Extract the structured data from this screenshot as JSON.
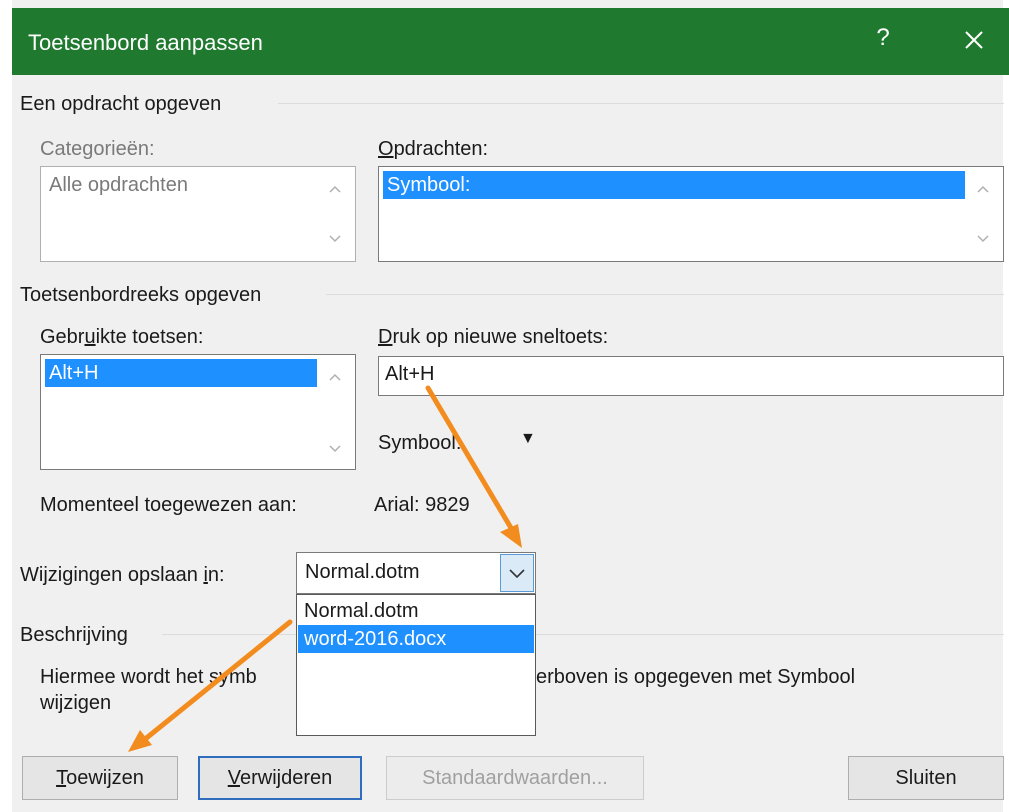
{
  "dialog": {
    "title": "Toetsenbord aanpassen",
    "help_label": "?",
    "close_icon": "close-icon"
  },
  "command_section": {
    "title": "Een opdracht opgeven",
    "categories_label": "Categorieën:",
    "categories_items": [
      "Alle opdrachten"
    ],
    "commands_label_underlined": "O",
    "commands_label_rest": "pdrachten:",
    "commands_items": [
      "Symbool:"
    ]
  },
  "keys_section": {
    "title": "Toetsenbordreeks opgeven",
    "used_keys_label_before": "Gebr",
    "used_keys_label_underlined": "u",
    "used_keys_label_after": "ikte toetsen:",
    "used_keys_items": [
      "Alt+H"
    ],
    "new_shortcut_label_underlined": "D",
    "new_shortcut_label_rest": "ruk op nieuwe sneltoets:",
    "new_shortcut_value": "Alt+H",
    "symbol_label": "Symbool:",
    "symbol_value": "▼"
  },
  "assigned": {
    "label": "Momenteel toegewezen aan:",
    "value": "Arial: 9829"
  },
  "save_in": {
    "label_before": "Wijzigingen opslaan ",
    "label_underlined": "i",
    "label_after": "n:",
    "selected": "Normal.dotm",
    "options": [
      "Normal.dotm",
      "word-2016.docx"
    ],
    "highlighted_index": 1
  },
  "description": {
    "title": "Beschrijving",
    "text_part1": "Hiermee wordt het symb",
    "text_part2": "erboven is opgegeven met Symbool",
    "text_line2": "wijzigen"
  },
  "buttons": {
    "assign_underlined": "T",
    "assign_rest": "oewijzen",
    "remove_underlined": "V",
    "remove_rest": "erwijderen",
    "reset": "Standaardwaarden...",
    "close": "Sluiten"
  },
  "colors": {
    "titlebar": "#1f7a2f",
    "selection": "#1e90ff",
    "annotation_arrow": "#f28c1e"
  }
}
